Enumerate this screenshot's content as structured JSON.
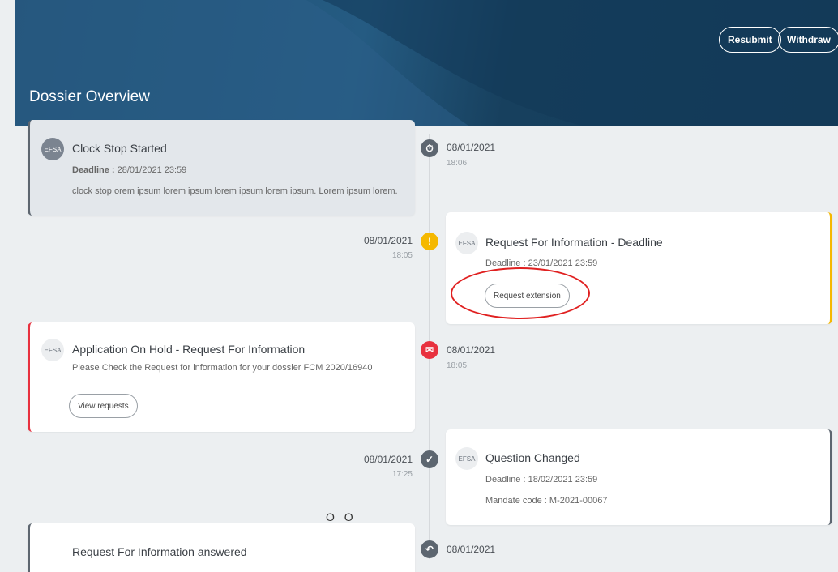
{
  "header": {
    "title": "Dossier Overview",
    "resubmit_label": "Resubmit",
    "withdraw_label": "Withdraw"
  },
  "events": [
    {
      "logo": "EFSA",
      "title": "Clock Stop Started",
      "deadline_label": "Deadline :",
      "deadline": "28/01/2021 23:59",
      "description": "clock stop orem ipsum lorem ipsum lorem ipsum lorem ipsum. Lorem ipsum lorem.",
      "date": "08/01/2021",
      "time": "18:06",
      "icon": "stopwatch-icon"
    },
    {
      "logo": "EFSA",
      "title": "Request For Information - Deadline",
      "deadline_label": "Deadline :",
      "deadline": "23/01/2021 23:59",
      "button_label": "Request extension",
      "date": "08/01/2021",
      "time": "18:05",
      "icon": "warning-icon"
    },
    {
      "logo": "EFSA",
      "title": "Application On Hold - Request For Information",
      "description": "Please Check the Request for information for your dossier FCM 2020/16940",
      "button_label": "View requests",
      "date": "08/01/2021",
      "time": "18:05",
      "icon": "envelope-icon"
    },
    {
      "logo": "EFSA",
      "title": "Question Changed",
      "deadline_label": "Deadline :",
      "deadline": "18/02/2021 23:59",
      "mandate_label": "Mandate code :",
      "mandate": "M-2021-00067",
      "date": "08/01/2021",
      "time": "17:25",
      "icon": "check-icon"
    },
    {
      "title": "Request For Information answered",
      "date": "08/01/2021",
      "icon": "reply-icon"
    }
  ],
  "loader_text": "O O",
  "colors": {
    "header": "#1f4f72",
    "warning": "#f5b800",
    "alert": "#e8313f",
    "neutral": "#5d6670",
    "annotation": "#e02020"
  }
}
